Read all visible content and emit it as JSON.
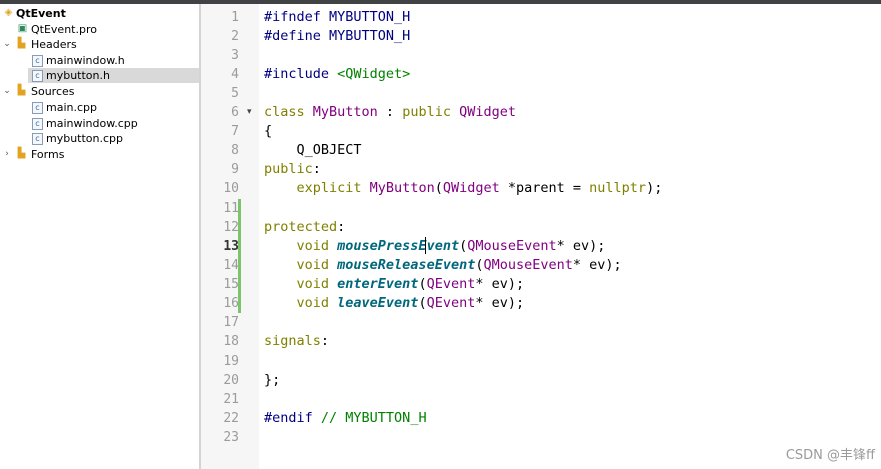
{
  "project_tree": {
    "project": "QtEvent",
    "pro_file": "QtEvent.pro",
    "headers_label": "Headers",
    "headers": [
      "mainwindow.h",
      "mybutton.h"
    ],
    "sources_label": "Sources",
    "sources": [
      "main.cpp",
      "mainwindow.cpp",
      "mybutton.cpp"
    ],
    "forms_label": "Forms"
  },
  "editor": {
    "line_numbers": [
      "1",
      "2",
      "3",
      "4",
      "5",
      "6",
      "7",
      "8",
      "9",
      "10",
      "11",
      "12",
      "13",
      "14",
      "15",
      "16",
      "17",
      "18",
      "19",
      "20",
      "21",
      "22",
      "23"
    ],
    "lines": {
      "l1_a": "#ifndef",
      "l1_b": " MYBUTTON_H",
      "l2_a": "#define",
      "l2_b": " MYBUTTON_H",
      "l4_a": "#include",
      "l4_b": " <QWidget>",
      "l6_a": "class",
      "l6_b": " MyButton",
      "l6_c": " : ",
      "l6_d": "public",
      "l6_e": " QWidget",
      "l7": "{",
      "l8": "    Q_OBJECT",
      "l9_a": "public",
      "l9_b": ":",
      "l10_a": "    explicit",
      "l10_b": " MyButton",
      "l10_c": "(",
      "l10_d": "QWidget",
      "l10_e": " *parent = ",
      "l10_f": "nullptr",
      "l10_g": ");",
      "l12_a": "protected",
      "l12_b": ":",
      "l13_a": "    void",
      "l13_b": " mousePressEvent",
      "l13_c": "(",
      "l13_d": "QMouseEvent",
      "l13_e": "* ev);",
      "l14_a": "    void",
      "l14_b": " mouseReleaseEvent",
      "l14_c": "(",
      "l14_d": "QMouseEvent",
      "l14_e": "* ev);",
      "l15_a": "    void",
      "l15_b": " enterEvent",
      "l15_c": "(",
      "l15_d": "QEvent",
      "l15_e": "* ev);",
      "l16_a": "    void",
      "l16_b": " leaveEvent",
      "l16_c": "(",
      "l16_d": "QEvent",
      "l16_e": "* ev);",
      "l18_a": "signals",
      "l18_b": ":",
      "l20": "};",
      "l22_a": "#endif",
      "l22_b": " // MYBUTTON_H"
    },
    "current_line": "13"
  },
  "watermark": "CSDN @丰锋ff"
}
